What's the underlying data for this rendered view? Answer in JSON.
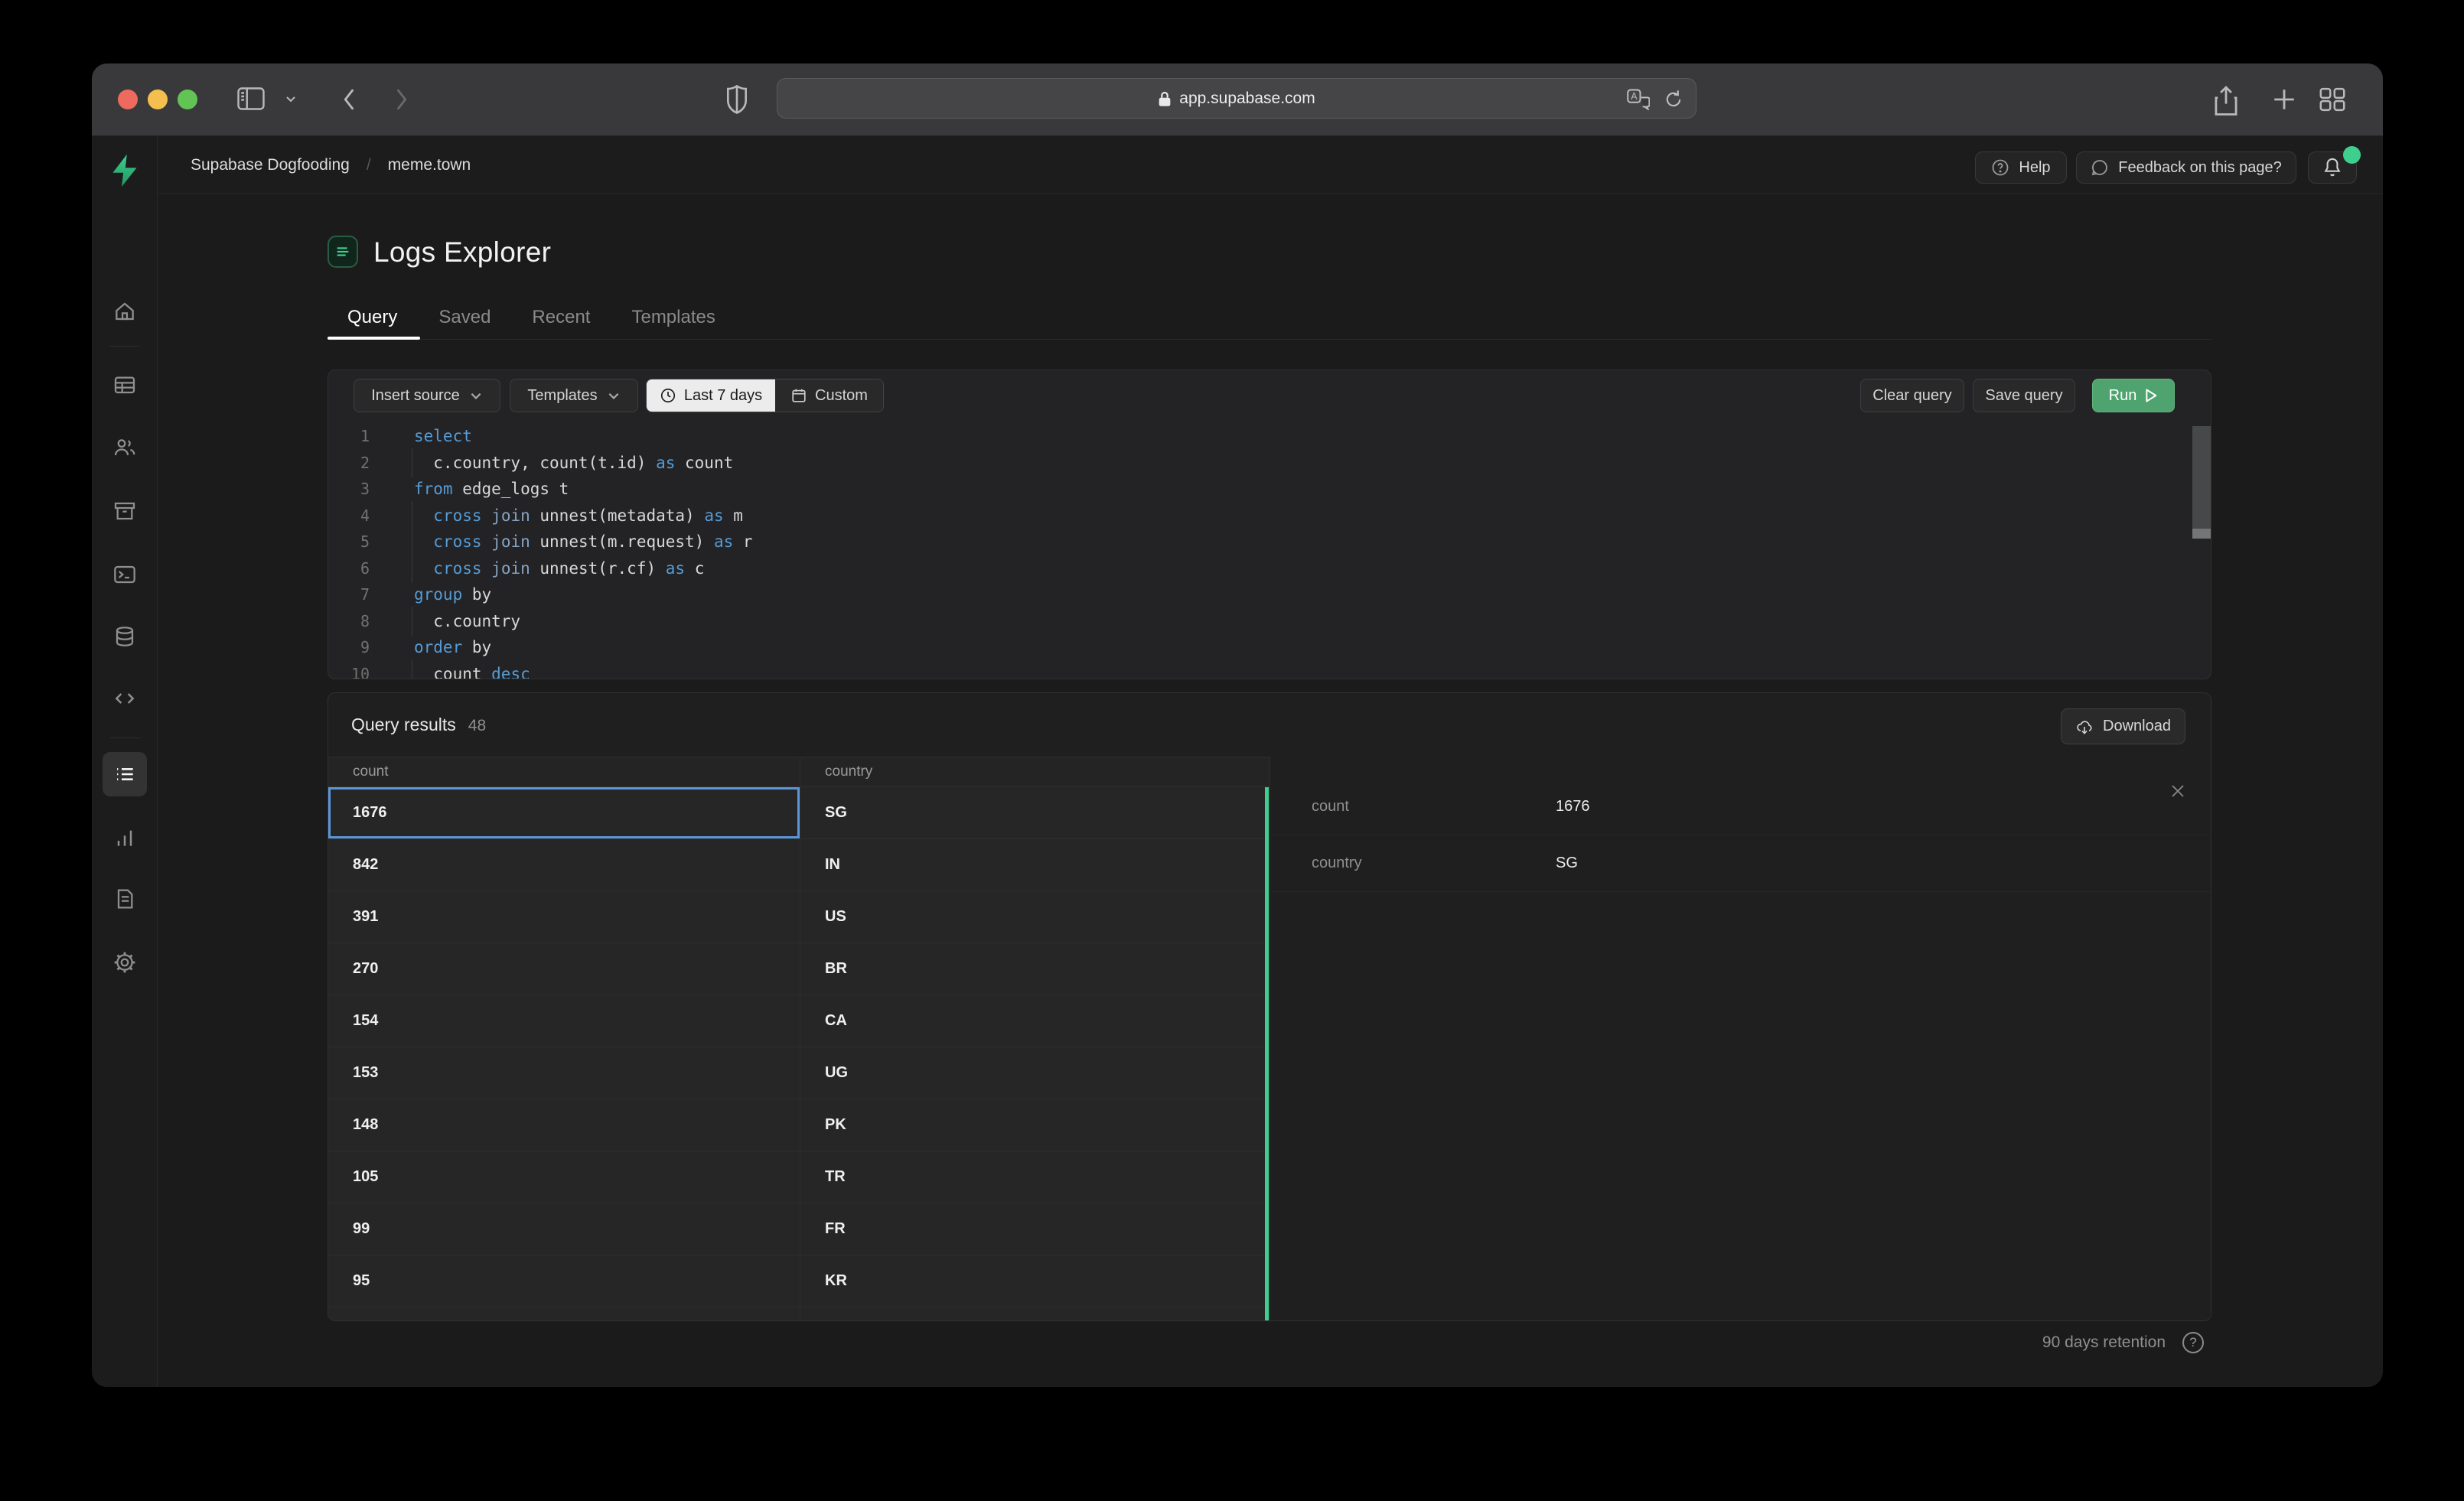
{
  "browser": {
    "url": "app.supabase.com"
  },
  "topbar": {
    "project": "Supabase Dogfooding",
    "separator": "/",
    "page": "meme.town",
    "help": "Help",
    "feedback": "Feedback on this page?"
  },
  "page": {
    "title": "Logs Explorer",
    "tabs": [
      {
        "label": "Query",
        "active": true
      },
      {
        "label": "Saved",
        "active": false
      },
      {
        "label": "Recent",
        "active": false
      },
      {
        "label": "Templates",
        "active": false
      }
    ]
  },
  "toolbar": {
    "insert_source": "Insert source",
    "templates": "Templates",
    "time_range": "Last 7 days",
    "custom": "Custom",
    "clear": "Clear query",
    "save": "Save query",
    "run": "Run"
  },
  "editor": {
    "lines": [
      {
        "n": "1",
        "indent": false,
        "tokens": [
          [
            "select",
            "k"
          ]
        ]
      },
      {
        "n": "2",
        "indent": true,
        "tokens": [
          [
            "  c.country, count(t.id) ",
            "d"
          ],
          [
            "as",
            "k"
          ],
          [
            " count",
            "d"
          ]
        ]
      },
      {
        "n": "3",
        "indent": false,
        "tokens": [
          [
            "from",
            "k"
          ],
          [
            " edge_logs t",
            "d"
          ]
        ]
      },
      {
        "n": "4",
        "indent": true,
        "tokens": [
          [
            "  ",
            "d"
          ],
          [
            "cross",
            "k"
          ],
          [
            " ",
            "d"
          ],
          [
            "join",
            "j"
          ],
          [
            " unnest(metadata) ",
            "d"
          ],
          [
            "as",
            "k"
          ],
          [
            " m",
            "d"
          ]
        ]
      },
      {
        "n": "5",
        "indent": true,
        "tokens": [
          [
            "  ",
            "d"
          ],
          [
            "cross",
            "k"
          ],
          [
            " ",
            "d"
          ],
          [
            "join",
            "j"
          ],
          [
            " unnest(m.request) ",
            "d"
          ],
          [
            "as",
            "k"
          ],
          [
            " r",
            "d"
          ]
        ]
      },
      {
        "n": "6",
        "indent": true,
        "tokens": [
          [
            "  ",
            "d"
          ],
          [
            "cross",
            "k"
          ],
          [
            " ",
            "d"
          ],
          [
            "join",
            "j"
          ],
          [
            " unnest(r.cf) ",
            "d"
          ],
          [
            "as",
            "k"
          ],
          [
            " c",
            "d"
          ]
        ]
      },
      {
        "n": "7",
        "indent": false,
        "tokens": [
          [
            "group",
            "k"
          ],
          [
            " by",
            "d"
          ]
        ]
      },
      {
        "n": "8",
        "indent": true,
        "tokens": [
          [
            "  c.country",
            "d"
          ]
        ]
      },
      {
        "n": "9",
        "indent": false,
        "tokens": [
          [
            "order",
            "k"
          ],
          [
            " by",
            "d"
          ]
        ]
      },
      {
        "n": "10",
        "indent": true,
        "tokens": [
          [
            "  count ",
            "d"
          ],
          [
            "desc",
            "k"
          ]
        ]
      }
    ]
  },
  "results": {
    "title": "Query results",
    "count_badge": "48",
    "download": "Download",
    "columns": [
      "count",
      "country"
    ],
    "rows": [
      [
        "1676",
        "SG"
      ],
      [
        "842",
        "IN"
      ],
      [
        "391",
        "US"
      ],
      [
        "270",
        "BR"
      ],
      [
        "154",
        "CA"
      ],
      [
        "153",
        "UG"
      ],
      [
        "148",
        "PK"
      ],
      [
        "105",
        "TR"
      ],
      [
        "99",
        "FR"
      ],
      [
        "95",
        "KR"
      ]
    ],
    "selected_row": 0
  },
  "detail": {
    "fields": [
      {
        "label": "count",
        "value": "1676"
      },
      {
        "label": "country",
        "value": "SG"
      }
    ]
  },
  "footer": {
    "retention": "90 days retention"
  },
  "colors": {
    "accent_green": "#3ECF8E",
    "run_green": "#4FA36E",
    "selection_blue": "#5B96D9",
    "keyword_blue": "#569CD6"
  }
}
